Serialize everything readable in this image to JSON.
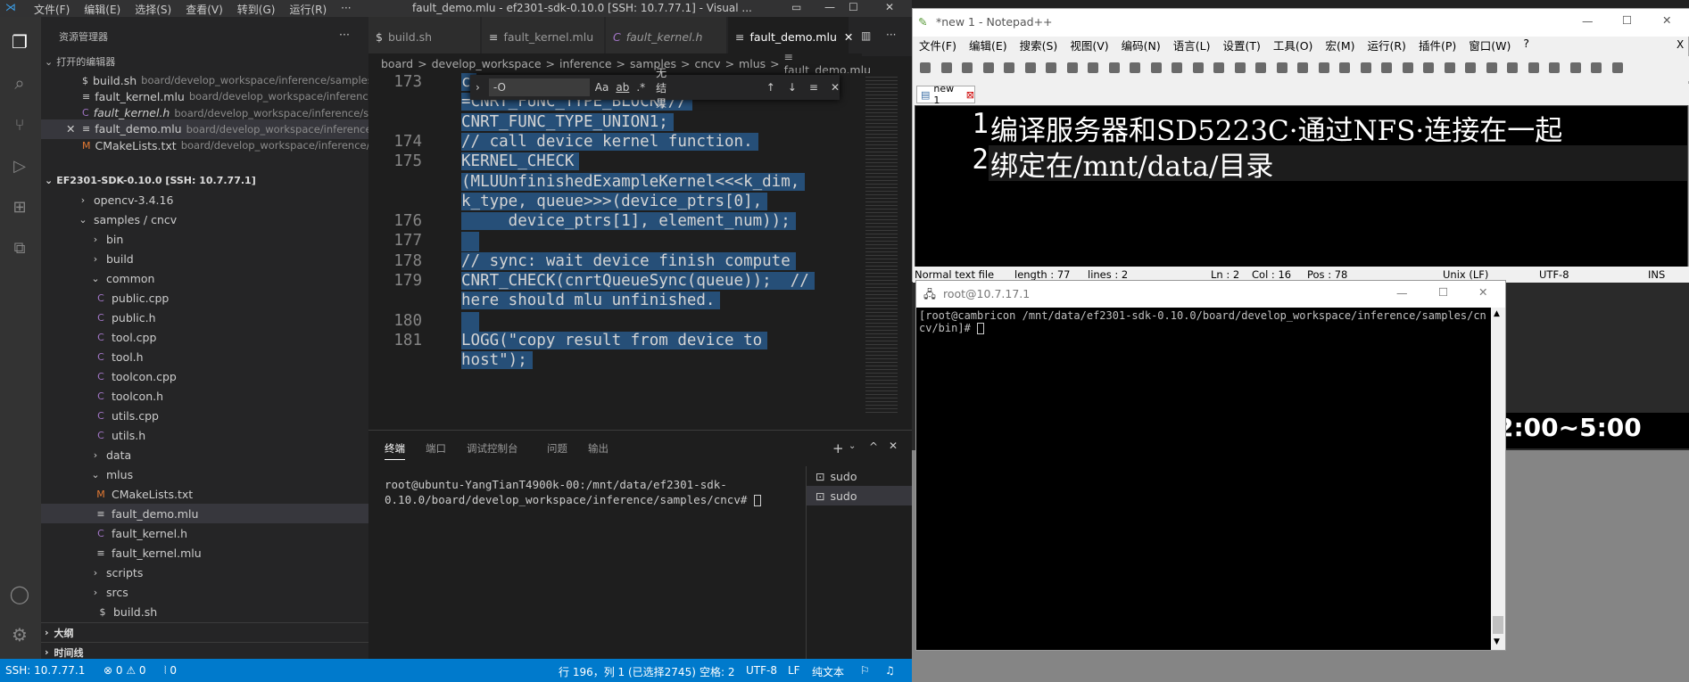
{
  "vscode": {
    "menu": [
      "文件(F)",
      "编辑(E)",
      "选择(S)",
      "查看(V)",
      "转到(G)",
      "运行(R)",
      "···"
    ],
    "title": "fault_demo.mlu - ef2301-sdk-0.10.0 [SSH: 10.7.77.1] - Visual ...",
    "explorer_title": "资源管理器",
    "open_editors_title": "打开的编辑器",
    "open_editors": [
      {
        "icon": "$",
        "name": "build.sh",
        "path": "board/develop_workspace/inference/samples/..."
      },
      {
        "icon": "≡",
        "name": "fault_kernel.mlu",
        "path": "board/develop_workspace/inference/..."
      },
      {
        "icon": "C",
        "name": "fault_kernel.h",
        "path": "board/develop_workspace/inference/sam..."
      },
      {
        "icon": "≡",
        "name": "fault_demo.mlu",
        "path": "board/develop_workspace/inference/s..."
      },
      {
        "icon": "M",
        "name": "CMakeLists.txt",
        "path": "board/develop_workspace/inference/sa..."
      }
    ],
    "workspace_title": "EF2301-SDK-0.10.0 [SSH: 10.7.77.1]",
    "tree": [
      {
        "name": "opencv-3.4.16",
        "arrow": "›",
        "icon": ""
      },
      {
        "name": "samples / cncv",
        "arrow": "⌄",
        "icon": ""
      },
      {
        "name": "bin",
        "arrow": "›",
        "icon": ""
      },
      {
        "name": "build",
        "arrow": "›",
        "icon": ""
      },
      {
        "name": "common",
        "arrow": "⌄",
        "icon": ""
      },
      {
        "name": "public.cpp",
        "arrow": "",
        "icon": "C"
      },
      {
        "name": "public.h",
        "arrow": "",
        "icon": "C"
      },
      {
        "name": "tool.cpp",
        "arrow": "",
        "icon": "C"
      },
      {
        "name": "tool.h",
        "arrow": "",
        "icon": "C"
      },
      {
        "name": "toolcon.cpp",
        "arrow": "",
        "icon": "C"
      },
      {
        "name": "toolcon.h",
        "arrow": "",
        "icon": "C"
      },
      {
        "name": "utils.cpp",
        "arrow": "",
        "icon": "C"
      },
      {
        "name": "utils.h",
        "arrow": "",
        "icon": "C"
      },
      {
        "name": "data",
        "arrow": "›",
        "icon": ""
      },
      {
        "name": "mlus",
        "arrow": "⌄",
        "icon": ""
      },
      {
        "name": "CMakeLists.txt",
        "arrow": "",
        "icon": "M"
      },
      {
        "name": "fault_demo.mlu",
        "arrow": "",
        "icon": "≡"
      },
      {
        "name": "fault_kernel.h",
        "arrow": "",
        "icon": "C"
      },
      {
        "name": "fault_kernel.mlu",
        "arrow": "",
        "icon": "≡"
      },
      {
        "name": "scripts",
        "arrow": "›",
        "icon": ""
      },
      {
        "name": "srcs",
        "arrow": "›",
        "icon": ""
      },
      {
        "name": "build.sh",
        "arrow": "",
        "icon": "$"
      }
    ],
    "outline_title": "大纲",
    "timeline_title": "时间线",
    "tabs": [
      {
        "icon": "$",
        "name": "build.sh"
      },
      {
        "icon": "≡",
        "name": "fault_kernel.mlu"
      },
      {
        "icon": "C",
        "name": "fault_kernel.h"
      },
      {
        "icon": "≡",
        "name": "fault_demo.mlu"
      }
    ],
    "breadcrumb": [
      "board",
      ">",
      "develop_workspace",
      ">",
      "inference",
      ">",
      "samples",
      ">",
      "cncv",
      ">",
      "mlus",
      ">",
      "≡ fault_demo.mlu"
    ],
    "find": {
      "query": "-O",
      "opt_case": "Aa",
      "opt_word": "ab",
      "opt_regex": ".*",
      "result": "无结果"
    },
    "code": [
      {
        "num": "173",
        "text": "c"
      },
      {
        "num": "",
        "text": "=CNRT_FUNC_TYPE_BLOCK;//"
      },
      {
        "num": "",
        "text": "CNRT_FUNC_TYPE_UNION1;"
      },
      {
        "num": "174",
        "text": "// call device kernel function."
      },
      {
        "num": "175",
        "text": "KERNEL_CHECK"
      },
      {
        "num": "",
        "text": "(MLUUnfinishedExampleKernel<<<k_dim,"
      },
      {
        "num": "",
        "text": "k_type, queue>>>(device_ptrs[0],"
      },
      {
        "num": "176",
        "text": "     device_ptrs[1], element_num));"
      },
      {
        "num": "177",
        "text": ""
      },
      {
        "num": "178",
        "text": "// sync: wait device finish compute"
      },
      {
        "num": "179",
        "text": "CNRT_CHECK(cnrtQueueSync(queue));  //"
      },
      {
        "num": "",
        "text": "here should mlu unfinished."
      },
      {
        "num": "180",
        "text": ""
      },
      {
        "num": "181",
        "text": "LOGG(\"copy result from device to"
      },
      {
        "num": "",
        "text": "host\");"
      }
    ],
    "panel_tabs": [
      "终端",
      "端口",
      "调试控制台",
      "问题",
      "输出"
    ],
    "terminal_text": "root@ubuntu-YangTianT4900k-00:/mnt/data/ef2301-sdk-0.10.0/board/develop_workspace/inference/samples/cncv#",
    "terminal_list": [
      "sudo",
      "sudo"
    ],
    "status": {
      "ssh": "SSH: 10.7.77.1",
      "errors": "⊗ 0 ⚠ 0",
      "ports": "⦚ 0",
      "position": "行 196，列 1 (已选择2745)",
      "spaces": "空格: 2",
      "encoding": "UTF-8",
      "eol": "LF",
      "lang": "纯文本"
    }
  },
  "notepad": {
    "title": "*new 1 - Notepad++",
    "menu": [
      "文件(F)",
      "编辑(E)",
      "搜索(S)",
      "视图(V)",
      "编码(N)",
      "语言(L)",
      "设置(T)",
      "工具(O)",
      "宏(M)",
      "运行(R)",
      "插件(P)",
      "窗口(W)",
      "?"
    ],
    "tab": "new 1",
    "lines": [
      {
        "num": "1",
        "text": "编译服务器和SD5223C·通过NFS·连接在一起"
      },
      {
        "num": "2",
        "text": "绑定在/mnt/data/目录"
      }
    ],
    "status": {
      "type": "Normal text file",
      "length": "length : 77",
      "lines": "lines : 2",
      "ln": "Ln : 2",
      "col": "Col : 16",
      "pos": "Pos : 78",
      "eol": "Unix (LF)",
      "enc": "UTF-8",
      "ins": "INS"
    }
  },
  "putty": {
    "title": "root@10.7.17.1",
    "text": "[root@cambricon /mnt/data/ef2301-sdk-0.10.0/board/develop_workspace/inference/samples/cncv/bin]#"
  },
  "background": {
    "time": "2:00~5:00"
  }
}
